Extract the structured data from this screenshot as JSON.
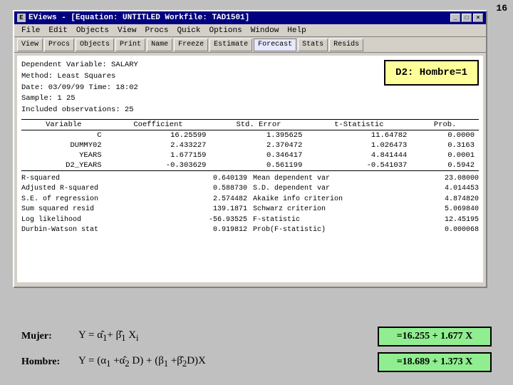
{
  "page": {
    "number": "16"
  },
  "window": {
    "title": "EViews - [Equation: UNTITLED   Workfile: TAD1501]",
    "menu": [
      "File",
      "Edit",
      "Objects",
      "View",
      "Procs",
      "Quick",
      "Options",
      "Window",
      "Help"
    ],
    "toolbar": [
      "View",
      "Procs",
      "Objects",
      "Print",
      "Name",
      "Freeze",
      "Estimate",
      "Forecast",
      "Stats",
      "Resids"
    ]
  },
  "equation": {
    "dependent_var": "Dependent Variable: SALARY",
    "method": "Method: Least Squares",
    "date": "Date: 03/09/99   Time: 18:02",
    "sample": "Sample: 1 25",
    "observations": "Included observations: 25",
    "d2_label": "D2: Hombre=1",
    "table": {
      "headers": [
        "Variable",
        "Coefficient",
        "Std. Error",
        "t-Statistic",
        "Prob."
      ],
      "rows": [
        [
          "C",
          "16.25599",
          "1.395625",
          "11.64782",
          "0.0000"
        ],
        [
          "DUMMY02",
          "2.433227",
          "2.370472",
          "1.026473",
          "0.3163"
        ],
        [
          "YEARS",
          "1.677159",
          "0.346417",
          "4.841444",
          "0.0001"
        ],
        [
          "D2_YEARS",
          "-0.303629",
          "0.561199",
          "-0.541037",
          "0.5942"
        ]
      ]
    },
    "stats_left": [
      [
        "R-squared",
        "0.640139"
      ],
      [
        "Adjusted R-squared",
        "0.588730"
      ],
      [
        "S.E. of regression",
        "2.574482"
      ],
      [
        "Sum squared resid",
        "139.1871"
      ],
      [
        "Log likelihood",
        "-56.93525"
      ],
      [
        "Durbin-Watson stat",
        "0.919812"
      ]
    ],
    "stats_right": [
      [
        "Mean dependent var",
        "23.08000"
      ],
      [
        "S.D. dependent var",
        "4.014453"
      ],
      [
        "Akaike info criterion",
        "4.874820"
      ],
      [
        "Schwarz criterion",
        "5.069840"
      ],
      [
        "F-statistic",
        "12.45195"
      ],
      [
        "Prob(F-statistic)",
        "0.000068"
      ]
    ]
  },
  "formulas": {
    "mujer_label": "Mujer:",
    "mujer_eq": "Y = α̂₁+ β̂₁ Xᵢ",
    "mujer_result": "=16.255 + 1.677 X",
    "hombre_label": "Hombre:",
    "hombre_eq": "Y = (α₁ +α̂₂ D) + (β₁ +β̂₂D)X",
    "hombre_result": "=18.689 + 1.373 X"
  }
}
